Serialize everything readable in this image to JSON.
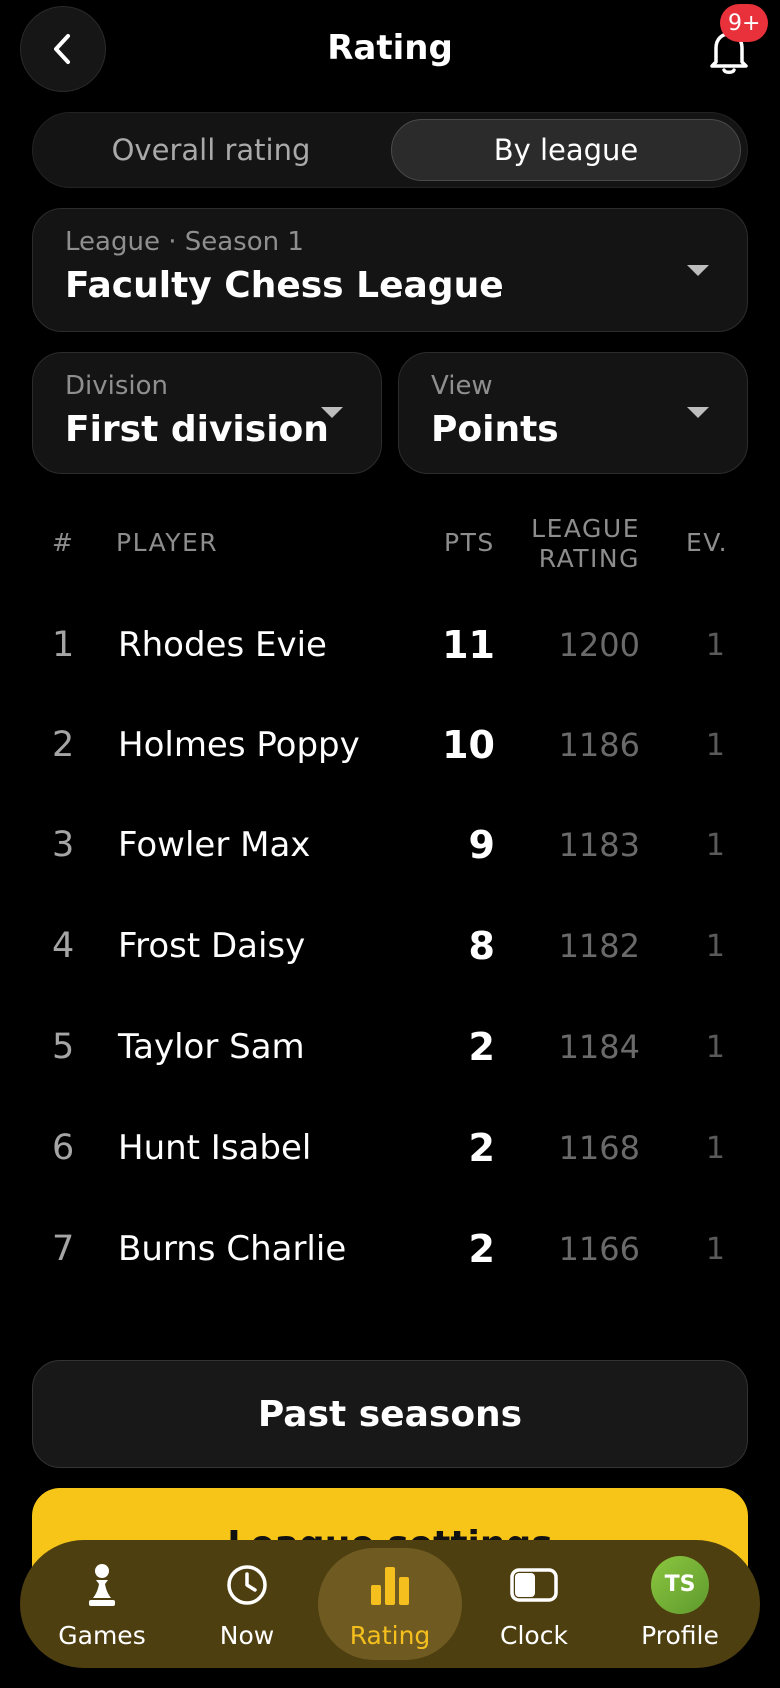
{
  "header": {
    "title": "Rating",
    "notification_badge": "9+"
  },
  "segmented": {
    "tabs": [
      {
        "label": "Overall rating"
      },
      {
        "label": "By league"
      }
    ],
    "selected": "By league"
  },
  "league_select": {
    "label": "League · Season 1",
    "value": "Faculty Chess League"
  },
  "division_select": {
    "label": "Division",
    "value": "First division"
  },
  "view_select": {
    "label": "View",
    "value": "Points"
  },
  "table": {
    "headers": {
      "rank": "#",
      "player": "PLAYER",
      "pts": "PTS",
      "league_rating_1": "LEAGUE",
      "league_rating_2": "RATING",
      "ev": "EV."
    },
    "rows": [
      {
        "rank": "1",
        "player": "Rhodes Evie",
        "pts": "11",
        "league_rating": "1200",
        "ev": "1"
      },
      {
        "rank": "2",
        "player": "Holmes Poppy",
        "pts": "10",
        "league_rating": "1186",
        "ev": "1"
      },
      {
        "rank": "3",
        "player": "Fowler Max",
        "pts": "9",
        "league_rating": "1183",
        "ev": "1"
      },
      {
        "rank": "4",
        "player": "Frost Daisy",
        "pts": "8",
        "league_rating": "1182",
        "ev": "1"
      },
      {
        "rank": "5",
        "player": "Taylor Sam",
        "pts": "2",
        "league_rating": "1184",
        "ev": "1"
      },
      {
        "rank": "6",
        "player": "Hunt Isabel",
        "pts": "2",
        "league_rating": "1168",
        "ev": "1"
      },
      {
        "rank": "7",
        "player": "Burns Charlie",
        "pts": "2",
        "league_rating": "1166",
        "ev": "1"
      }
    ]
  },
  "buttons": {
    "past_seasons": "Past seasons",
    "league_settings": "League settings"
  },
  "tabbar": {
    "items": [
      {
        "label": "Games",
        "icon": "pawn-icon"
      },
      {
        "label": "Now",
        "icon": "clock-icon"
      },
      {
        "label": "Rating",
        "icon": "bar-chart-icon"
      },
      {
        "label": "Clock",
        "icon": "chess-clock-icon"
      },
      {
        "label": "Profile",
        "icon": "avatar",
        "initials": "TS"
      }
    ],
    "active": "Rating"
  },
  "colors": {
    "accent": "#f6c518",
    "badge": "#e8313a",
    "background": "#000000"
  }
}
